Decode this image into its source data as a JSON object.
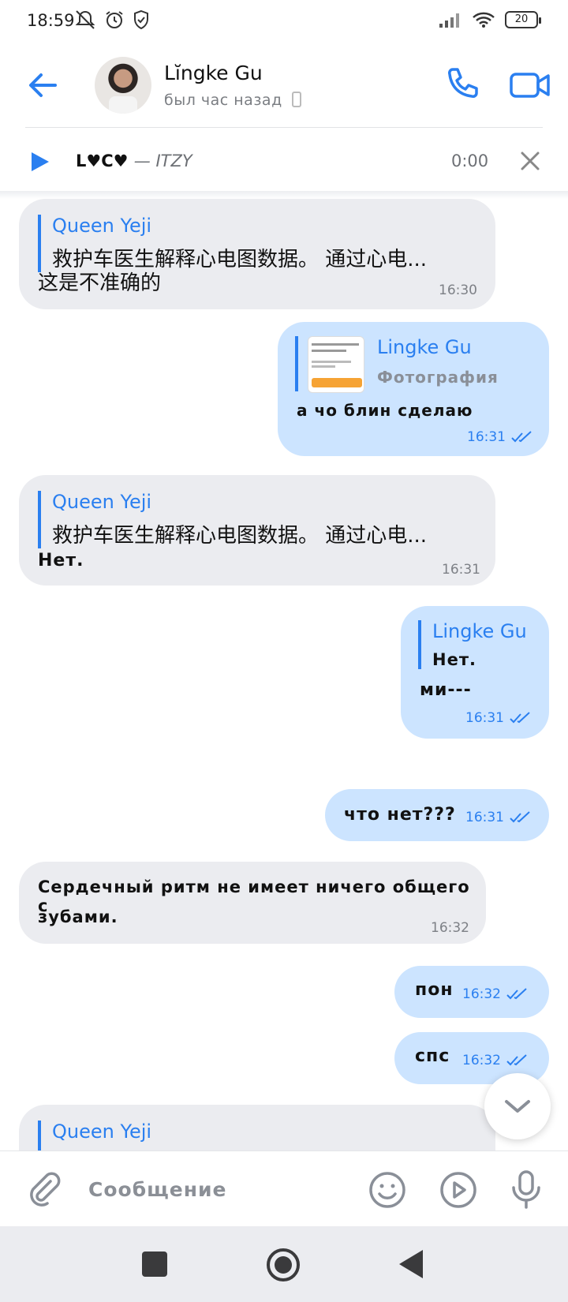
{
  "status_bar": {
    "time": "18:59",
    "battery": "20"
  },
  "header": {
    "name": "Lĭngke Gu",
    "last_seen": "был час назад"
  },
  "player": {
    "title": "L♥C♥",
    "artist": "— ITZY",
    "time": "0:00"
  },
  "messages": [
    {
      "direction": "incoming",
      "reply_author": "Queen Yeji",
      "reply_text": "救护车医生解释心电图数据。 通过心电...",
      "text": "这是不准确的",
      "time": "16:30"
    },
    {
      "direction": "outgoing",
      "reply_author": "Lingke Gu",
      "reply_text": "Фотография",
      "text": "а чо блин сделаю",
      "time": "16:31"
    },
    {
      "direction": "incoming",
      "reply_author": "Queen Yeji",
      "reply_text": "救护车医生解释心电图数据。 通过心电...",
      "text": "Нет.",
      "time": "16:31"
    },
    {
      "direction": "outgoing",
      "reply_author": "Lingke Gu",
      "reply_text": "Нет.",
      "text": "ми---",
      "time": "16:31"
    },
    {
      "direction": "outgoing",
      "text": "что нет???",
      "time": "16:31"
    },
    {
      "direction": "incoming",
      "text_line1": "Сердечный ритм не имеет ничего общего с",
      "text_line2": "зубами.",
      "time": "16:32"
    },
    {
      "direction": "outgoing",
      "text": "пон",
      "time": "16:32"
    },
    {
      "direction": "outgoing",
      "text": "спс",
      "time": "16:32"
    },
    {
      "direction": "incoming",
      "reply_author": "Queen Yeji"
    }
  ],
  "composer": {
    "placeholder": "Сообщение"
  },
  "colors": {
    "accent": "#2a7ff0",
    "incoming_bubble": "#ebecf0",
    "outgoing_bubble": "#cce4ff"
  },
  "icons": {
    "back": "arrow-left-icon",
    "call": "phone-icon",
    "video": "video-camera-icon",
    "play": "play-icon",
    "close": "close-icon",
    "attach": "paperclip-icon",
    "emoji": "smiley-icon",
    "clip": "play-circle-icon",
    "mic": "microphone-icon",
    "scroll": "chevron-down-icon"
  }
}
